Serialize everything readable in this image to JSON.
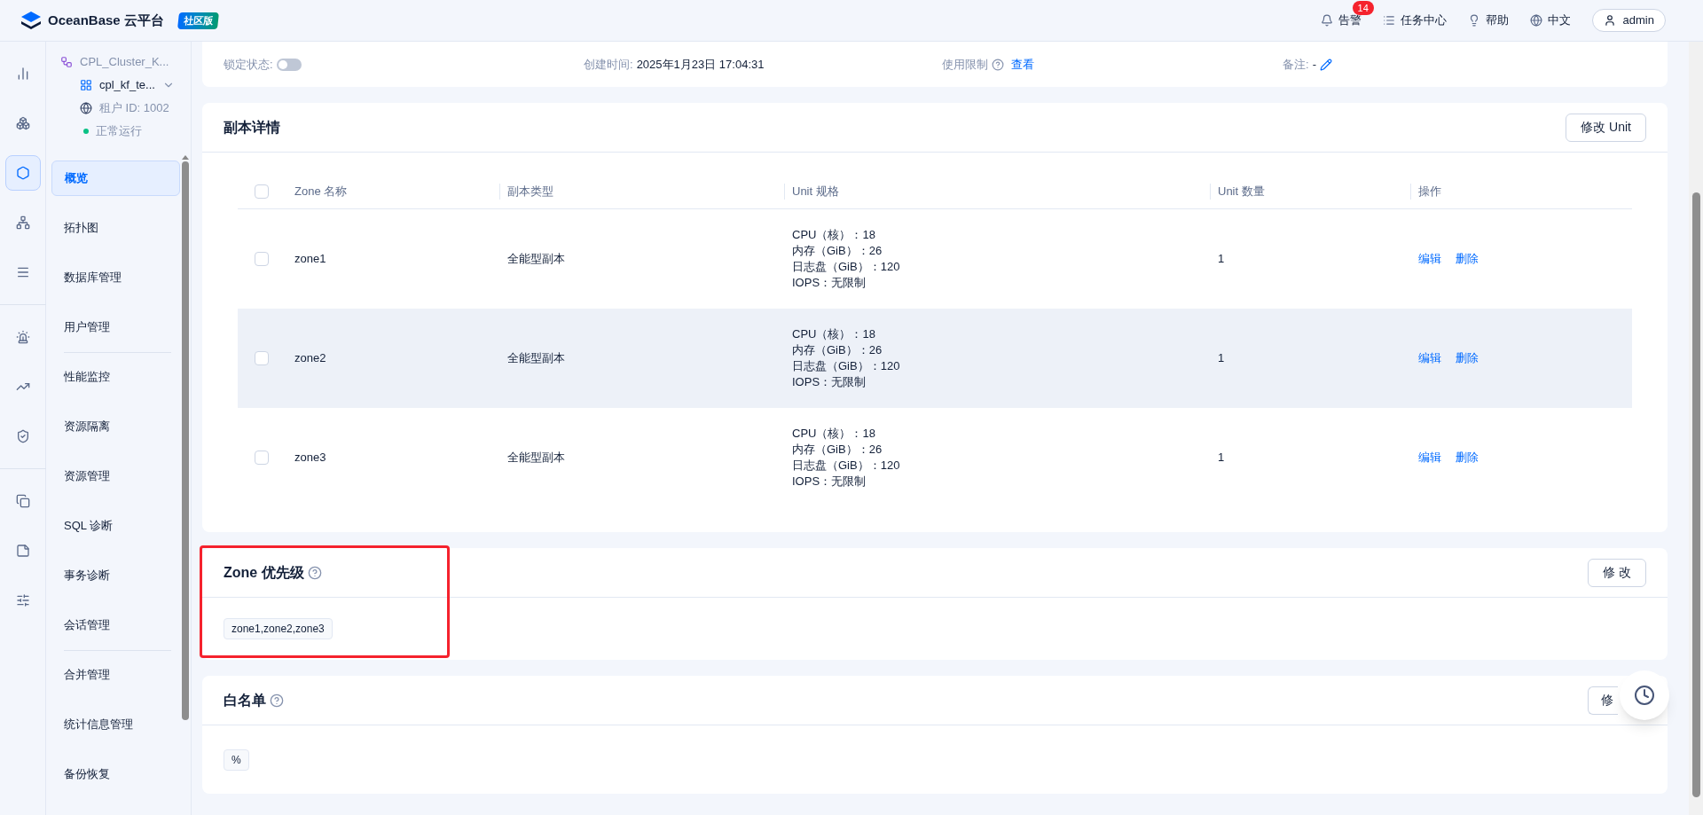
{
  "header": {
    "brand": "OceanBase 云平台",
    "edition": "社区版",
    "actions": [
      {
        "kind": "alert",
        "label": "告警",
        "badge": "14"
      },
      {
        "kind": "tasks",
        "label": "任务中心"
      },
      {
        "kind": "help",
        "label": "帮助"
      },
      {
        "kind": "lang",
        "label": "中文"
      }
    ],
    "user": "admin"
  },
  "rail": [
    {
      "kind": "chart",
      "selected": false
    },
    {
      "kind": "cluster",
      "selected": false
    },
    {
      "kind": "tenant",
      "selected": true
    },
    {
      "kind": "topology",
      "selected": false
    },
    {
      "kind": "list",
      "selected": false
    },
    {
      "kind": "alarm",
      "selected": false
    },
    {
      "kind": "monitor",
      "selected": false
    },
    {
      "kind": "shield",
      "selected": false
    },
    {
      "kind": "copy",
      "selected": false
    },
    {
      "kind": "note",
      "selected": false
    },
    {
      "kind": "sliders",
      "selected": false
    }
  ],
  "context": {
    "cluster": "CPL_Cluster_K...",
    "tenant": "cpl_kf_te...",
    "tenant_id": "租户 ID: 1002",
    "status": "正常运行"
  },
  "nav": [
    {
      "label": "概览",
      "selected": true
    },
    {
      "label": "拓扑图",
      "selected": false
    },
    {
      "label": "数据库管理",
      "selected": false
    },
    {
      "label": "用户管理",
      "selected": false,
      "divider_after": true
    },
    {
      "label": "性能监控",
      "selected": false
    },
    {
      "label": "资源隔离",
      "selected": false
    },
    {
      "label": "资源管理",
      "selected": false
    },
    {
      "label": "SQL 诊断",
      "selected": false
    },
    {
      "label": "事务诊断",
      "selected": false
    },
    {
      "label": "会话管理",
      "selected": false,
      "divider_after": true
    },
    {
      "label": "合并管理",
      "selected": false
    },
    {
      "label": "统计信息管理",
      "selected": false
    },
    {
      "label": "备份恢复",
      "selected": false
    }
  ],
  "info_row": {
    "lock_label": "锁定状态:",
    "lock_on": false,
    "created_label": "创建时间:",
    "created_value": "2025年1月23日 17:04:31",
    "limit_label": "使用限制",
    "limit_link": "查看",
    "note_label": "备注:",
    "note_value": "-"
  },
  "replica": {
    "title": "副本详情",
    "button": "修改 Unit",
    "columns": [
      "Zone 名称",
      "副本类型",
      "Unit 规格",
      "Unit 数量",
      "操作"
    ],
    "header_checked": false,
    "rows": [
      {
        "checked": false,
        "highlighted": false,
        "zone": "zone1",
        "type": "全能型副本",
        "spec": [
          "CPU（核）：18",
          "内存（GiB）：26",
          "日志盘（GiB）：120",
          "IOPS：无限制"
        ],
        "count": "1",
        "actions": [
          "编辑",
          "删除"
        ]
      },
      {
        "checked": false,
        "highlighted": true,
        "zone": "zone2",
        "type": "全能型副本",
        "spec": [
          "CPU（核）：18",
          "内存（GiB）：26",
          "日志盘（GiB）：120",
          "IOPS：无限制"
        ],
        "count": "1",
        "actions": [
          "编辑",
          "删除"
        ]
      },
      {
        "checked": false,
        "highlighted": false,
        "zone": "zone3",
        "type": "全能型副本",
        "spec": [
          "CPU（核）：18",
          "内存（GiB）：26",
          "日志盘（GiB）：120",
          "IOPS：无限制"
        ],
        "count": "1",
        "actions": [
          "编辑",
          "删除"
        ]
      }
    ]
  },
  "zone_priority": {
    "title": "Zone 优先级",
    "button": "修 改",
    "tag": "zone1,zone2,zone3",
    "highlighted": true
  },
  "whitelist": {
    "title": "白名单",
    "button": "修",
    "tag": "%"
  }
}
